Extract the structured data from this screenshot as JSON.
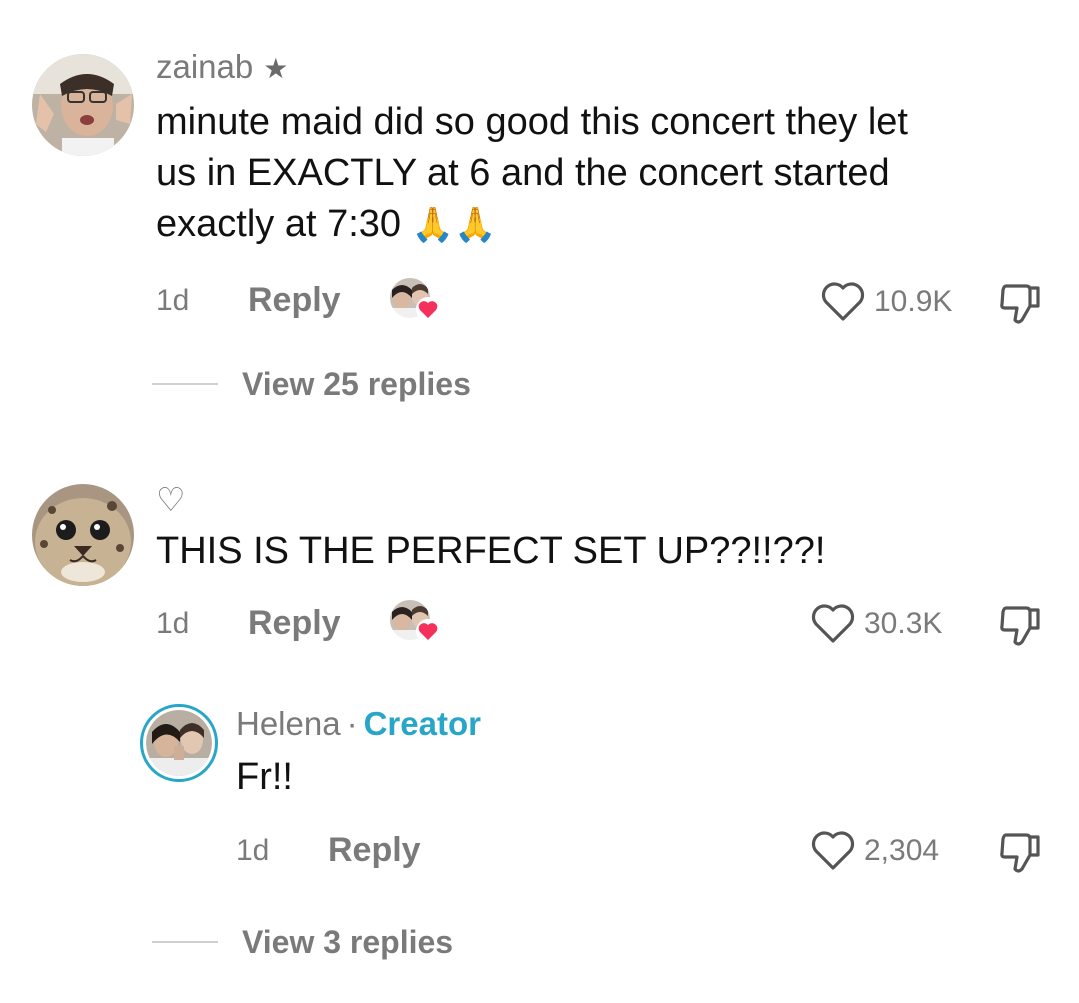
{
  "comments": [
    {
      "username": "zainab",
      "badge": "★",
      "text_lines": [
        "minute maid did so good this concert they let",
        "us in EXACTLY at 6 and the concert started",
        "exactly at 7:30"
      ],
      "emoji": "🙏🙏",
      "time": "1d",
      "reply_label": "Reply",
      "likes": "10.9K",
      "view_replies": "View 25 replies"
    },
    {
      "username": "♡",
      "text": "THIS IS THE PERFECT SET UP??!!??!",
      "time": "1d",
      "reply_label": "Reply",
      "likes": "30.3K"
    }
  ],
  "reply": {
    "username": "Helena",
    "separator": "·",
    "creator_label": "Creator",
    "text": "Fr!!",
    "time": "1d",
    "reply_label": "Reply",
    "likes": "2,304",
    "view_replies": "View 3 replies"
  },
  "icons": {
    "like": "heart-outline-icon",
    "dislike": "thumbs-down-icon",
    "creator_liked": "creator-heart-badge-icon"
  },
  "colors": {
    "creator_accent": "#27a6c7",
    "heart_red": "#f5305a",
    "muted": "#7a7a7a"
  }
}
